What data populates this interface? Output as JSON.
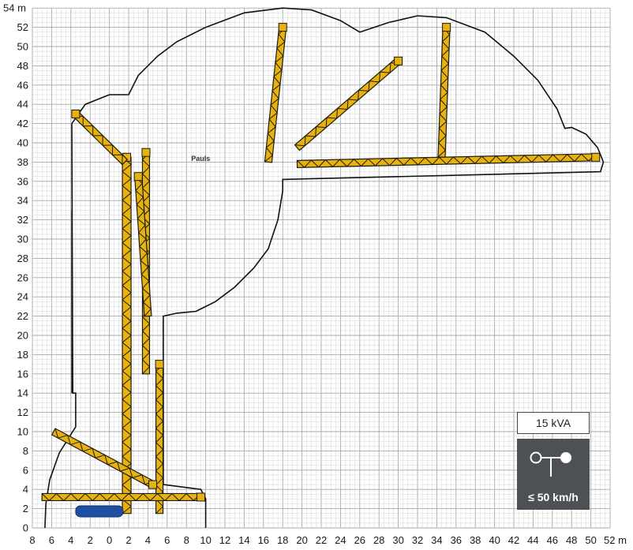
{
  "chart_data": {
    "type": "diagram",
    "x_axis": {
      "ticks": [
        "8",
        "6",
        "4",
        "2",
        "0",
        "2",
        "4",
        "6",
        "8",
        "10",
        "12",
        "14",
        "16",
        "18",
        "20",
        "22",
        "24",
        "26",
        "28",
        "30",
        "32",
        "34",
        "36",
        "38",
        "40",
        "42",
        "44",
        "46",
        "48",
        "50",
        "52"
      ],
      "unit": "m",
      "range": [
        -8,
        52
      ]
    },
    "y_axis": {
      "ticks": [
        "0",
        "2",
        "4",
        "6",
        "8",
        "10",
        "12",
        "14",
        "16",
        "18",
        "20",
        "22",
        "24",
        "26",
        "28",
        "30",
        "32",
        "34",
        "36",
        "38",
        "40",
        "42",
        "44",
        "46",
        "48",
        "50",
        "52",
        "54"
      ],
      "unit": "m",
      "range": [
        0,
        54
      ]
    },
    "boom_configurations": [
      {
        "tip": [
          3,
          36.5
        ]
      },
      {
        "tip": [
          -3.5,
          43
        ]
      },
      {
        "tip": [
          18,
          52
        ]
      },
      {
        "tip": [
          30,
          48.5
        ]
      },
      {
        "tip": [
          35,
          52
        ]
      },
      {
        "tip": [
          50.5,
          38.5
        ]
      }
    ],
    "brand_marking": "Pauls",
    "power_badge": "15 kVA",
    "wind_badge": "≤ 50 km/h",
    "colors": {
      "boom": "#e8b20c",
      "lattice": "#1a1a1a",
      "grid_minor": "#d3d3d3",
      "grid_major": "#a9a9a9",
      "badge_bg": "#4d5156"
    },
    "icons": [
      "wind-sign-icon"
    ]
  }
}
